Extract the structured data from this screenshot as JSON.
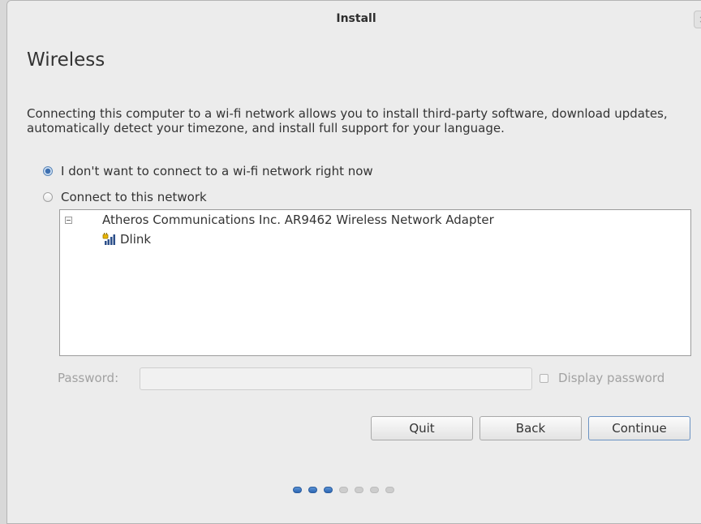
{
  "window": {
    "title": "Install",
    "close_label": "×"
  },
  "page": {
    "heading": "Wireless",
    "description": "Connecting this computer to a wi-fi network allows you to install third-party software, download updates, automatically detect your timezone, and install full support for your language."
  },
  "options": {
    "no_connect": {
      "label": "I don't want to connect to a wi-fi network right now",
      "selected": true
    },
    "connect": {
      "label": "Connect to this network",
      "selected": false
    }
  },
  "network_list": {
    "adapter": "Atheros Communications Inc. AR9462 Wireless Network Adapter",
    "networks": [
      {
        "name": "Dlink",
        "icon": "wifi-locked-icon"
      }
    ]
  },
  "password": {
    "label": "Password:",
    "value": "",
    "show_label": "Display password",
    "show_checked": false
  },
  "buttons": {
    "quit": "Quit",
    "back": "Back",
    "continue": "Continue"
  },
  "progress": {
    "total_steps": 7,
    "completed_steps": 3
  },
  "colors": {
    "accent": "#3d6fb0",
    "window_bg": "#ececec"
  }
}
